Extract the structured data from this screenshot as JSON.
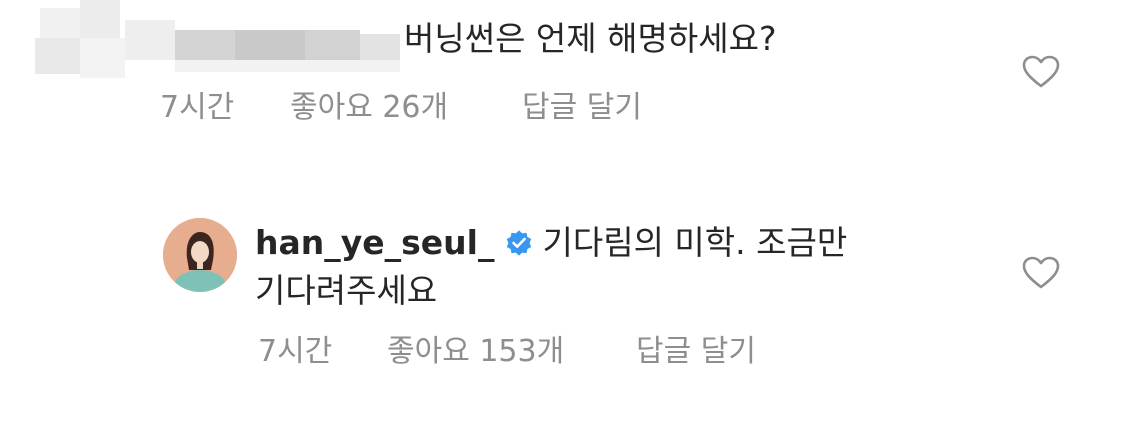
{
  "comments": [
    {
      "author_censored": true,
      "text": "버닝썬은 언제 해명하세요?",
      "time": "7시간",
      "likes": "좋아요 26개",
      "reply": "답글 달기"
    },
    {
      "author": "han_ye_seul_",
      "verified": true,
      "text_line1": "기다림의 미학. 조금만",
      "text_line2": "기다려주세요",
      "time": "7시간",
      "likes": "좋아요 153개",
      "reply": "답글 달기"
    }
  ],
  "icons": {
    "like": "heart-outline-icon",
    "verified": "verified-badge-icon"
  },
  "colors": {
    "text": "#262626",
    "meta": "#8e8e8e",
    "verified": "#3897f0"
  }
}
